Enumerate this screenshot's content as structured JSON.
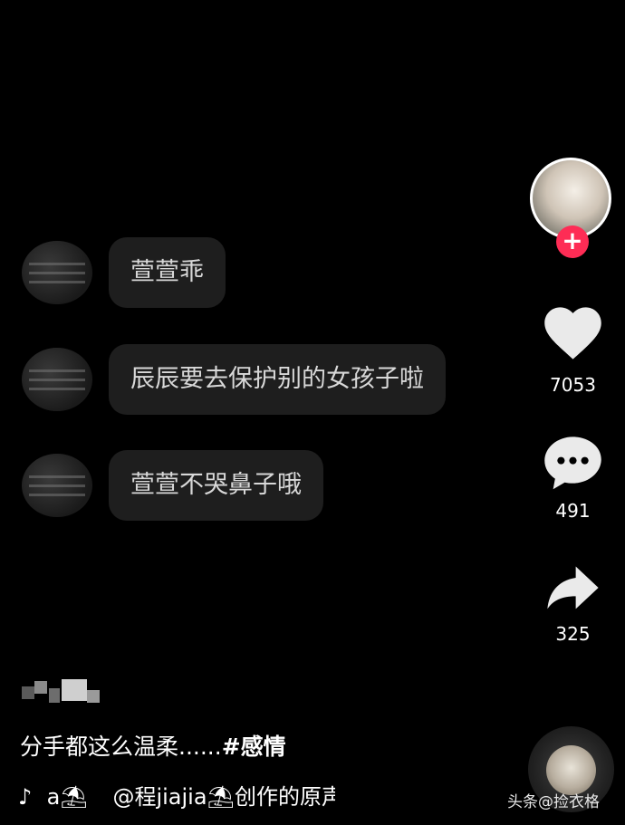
{
  "chat": {
    "messages": [
      {
        "text": "萱萱乖"
      },
      {
        "text": "辰辰要去保护别的女孩子啦"
      },
      {
        "text": "萱萱不哭鼻子哦"
      }
    ]
  },
  "actions": {
    "likes": "7053",
    "comments": "491",
    "shares": "325"
  },
  "caption": {
    "text": "分手都这么温柔......",
    "hashtag": "#感情"
  },
  "music": {
    "owner": "a⛱",
    "text": "@程jiajia⛱创作的原声"
  },
  "watermark": "头条@捡衣格",
  "colors": {
    "background": "#000000",
    "bubble": "#1e1e1e",
    "follow_accent": "#fe2c55"
  }
}
